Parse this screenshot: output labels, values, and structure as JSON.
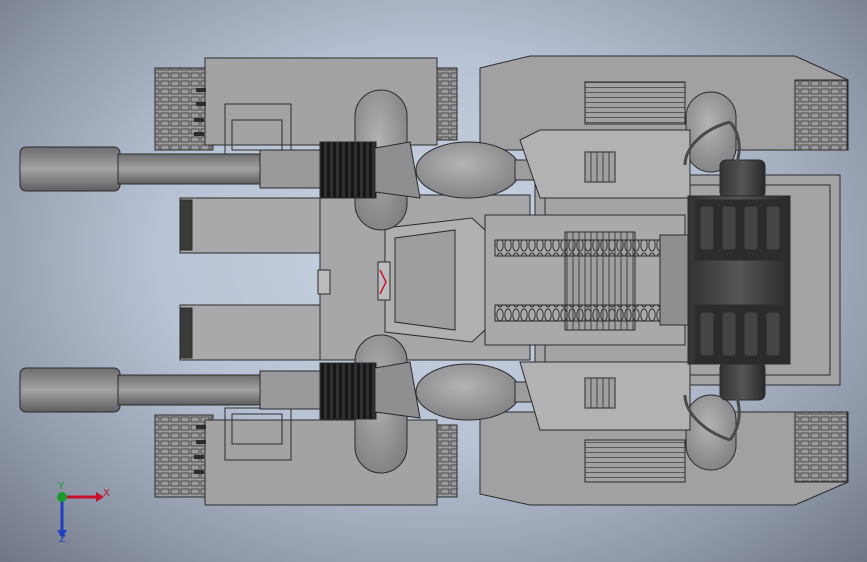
{
  "viewport": {
    "background_colors": [
      "#c9d3e2",
      "#b7c2d4",
      "#8d96a6",
      "#6f7685"
    ],
    "model_color": "#9a9a9c",
    "edge_color": "#2b2b2b"
  },
  "triad": {
    "x_label": "X",
    "y_label": "Y",
    "z_label": "Z",
    "x_color": "#c8102e",
    "y_color": "#1a9a2a",
    "z_color": "#1f3fbf"
  }
}
